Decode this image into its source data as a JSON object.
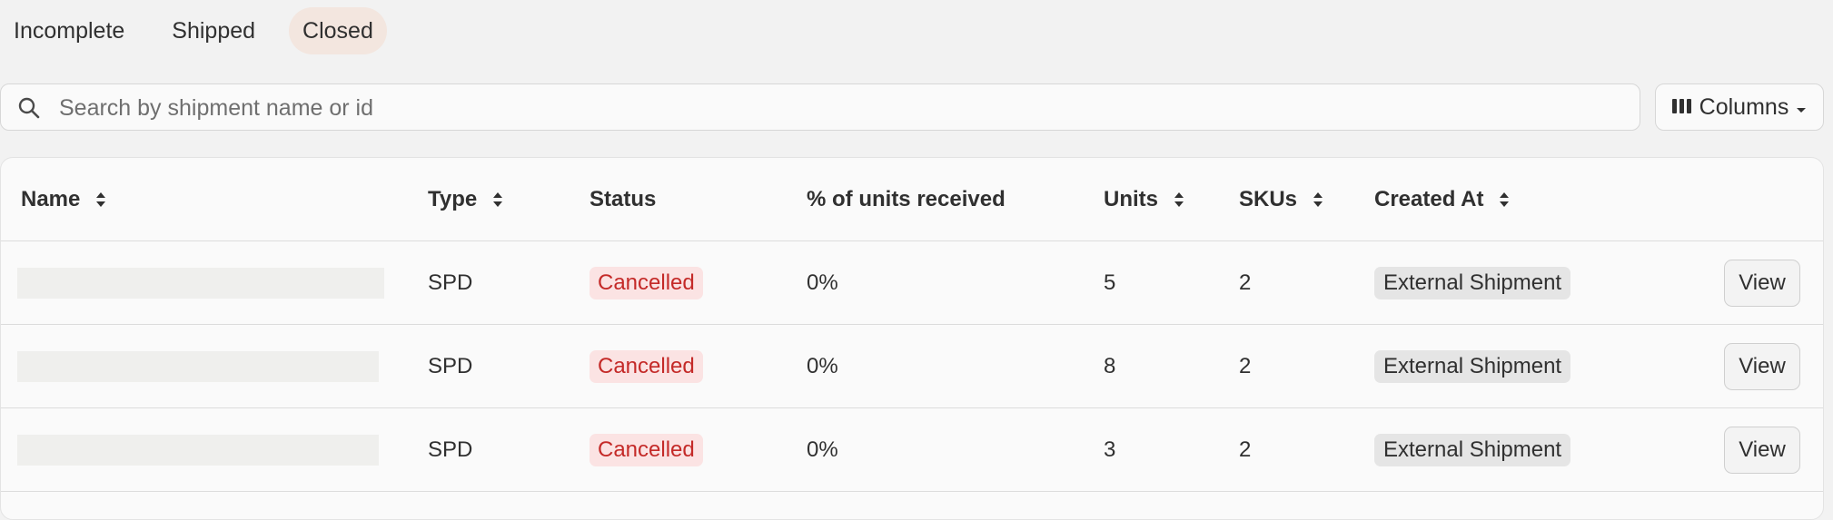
{
  "tabs": [
    {
      "label": "Incomplete",
      "active": false
    },
    {
      "label": "Shipped",
      "active": false
    },
    {
      "label": "Closed",
      "active": true
    }
  ],
  "search": {
    "placeholder": "Search by shipment name or id",
    "icon": "search-icon"
  },
  "columns_button": {
    "label": "Columns",
    "icon": "columns-icon"
  },
  "table": {
    "headers": {
      "name": "Name",
      "type": "Type",
      "status": "Status",
      "percent_received": "% of units received",
      "units": "Units",
      "skus": "SKUs",
      "created_at": "Created At"
    },
    "rows": [
      {
        "name": "",
        "type": "SPD",
        "status": "Cancelled",
        "percent_received": "0%",
        "units": "5",
        "skus": "2",
        "created_at": "External Shipment",
        "action": "View"
      },
      {
        "name": "",
        "type": "SPD",
        "status": "Cancelled",
        "percent_received": "0%",
        "units": "8",
        "skus": "2",
        "created_at": "External Shipment",
        "action": "View"
      },
      {
        "name": "",
        "type": "SPD",
        "status": "Cancelled",
        "percent_received": "0%",
        "units": "3",
        "skus": "2",
        "created_at": "External Shipment",
        "action": "View"
      }
    ]
  },
  "colors": {
    "background": "#f2f2f2",
    "active_tab": "#f3e6df",
    "cancelled_text": "#c42a28",
    "cancelled_bg": "#fbe3e3"
  }
}
